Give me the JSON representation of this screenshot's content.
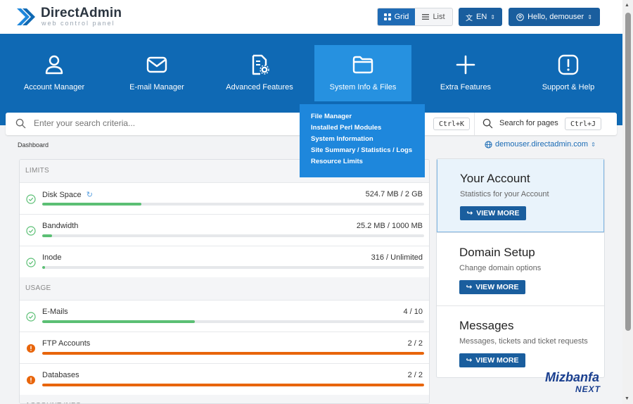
{
  "header": {
    "brand": "DirectAdmin",
    "brand_sub": "web control panel",
    "view_grid": "Grid",
    "view_list": "List",
    "lang": "EN",
    "user": "Hello, demouser"
  },
  "nav": {
    "items": [
      {
        "label": "Account Manager",
        "icon": "user-icon"
      },
      {
        "label": "E-mail Manager",
        "icon": "envelope-icon"
      },
      {
        "label": "Advanced Features",
        "icon": "file-gear-icon"
      },
      {
        "label": "System Info & Files",
        "icon": "folder-icon"
      },
      {
        "label": "Extra Features",
        "icon": "plus-icon"
      },
      {
        "label": "Support & Help",
        "icon": "alert-icon"
      }
    ],
    "active": "System Info & Files"
  },
  "dropdown": {
    "items": [
      "File Manager",
      "Installed Perl Modules",
      "System Information",
      "Site Summary / Statistics / Logs",
      "Resource Limits"
    ]
  },
  "search": {
    "placeholder": "Enter your search criteria...",
    "shortcut": "Ctrl+K",
    "pages_label": "Search for pages",
    "pages_shortcut": "Ctrl+J"
  },
  "breadcrumb": "Dashboard",
  "domain": "demouser.directadmin.com",
  "limits": {
    "sections": [
      {
        "title": "LIMITS"
      },
      {
        "title": "USAGE"
      },
      {
        "title": "ACCOUNT INFO"
      }
    ],
    "rows": [
      {
        "name": "Disk Space",
        "value": "524.7 MB / 2 GB",
        "fraction": 0.26,
        "status": "ok"
      },
      {
        "name": "Bandwidth",
        "value": "25.2 MB / 1000 MB",
        "fraction": 0.025,
        "status": "ok"
      },
      {
        "name": "Inode",
        "value": "316 / Unlimited",
        "fraction": 0.008,
        "status": "ok"
      },
      {
        "name": "E-Mails",
        "value": "4 / 10",
        "fraction": 0.4,
        "status": "ok"
      },
      {
        "name": "FTP Accounts",
        "value": "2 / 2",
        "fraction": 1.0,
        "status": "warning"
      },
      {
        "name": "Databases",
        "value": "2 / 2",
        "fraction": 1.0,
        "status": "warning"
      }
    ]
  },
  "cards": [
    {
      "title": "Your Account",
      "desc": "Statistics for your Account",
      "button": "VIEW MORE"
    },
    {
      "title": "Domain Setup",
      "desc": "Change domain options",
      "button": "VIEW MORE"
    },
    {
      "title": "Messages",
      "desc": "Messages, tickets and ticket requests",
      "button": "VIEW MORE"
    }
  ],
  "watermark": {
    "line1": "Mizbanfa",
    "line2": "NEXT"
  },
  "colors": {
    "primary": "#0f69b4",
    "accent": "#1e87dc",
    "ok": "#5bbf74",
    "warning": "#e8650b"
  }
}
